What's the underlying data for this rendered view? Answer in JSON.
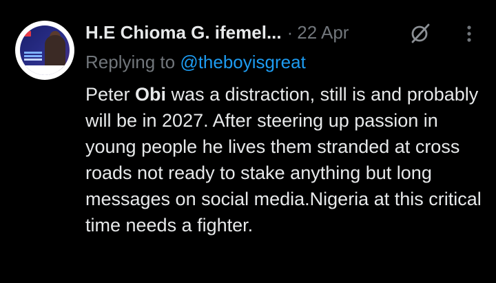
{
  "tweet": {
    "author": {
      "display_name": "H.E Chioma G. ifemel...",
      "avatar": "profile-avatar"
    },
    "separator": "·",
    "date": "22 Apr",
    "reply": {
      "prefix": "Replying to",
      "handle": "@theboyisgreat"
    },
    "body": {
      "part1": "Peter ",
      "bold": "Obi",
      "part2": " was a distraction, still is and probably will be in 2027. After steering up passion in young people he lives them stranded at cross roads not ready to stake anything but long messages on social media.Nigeria at this critical time needs a fighter."
    },
    "icons": {
      "grok": "grok-icon",
      "more": "more-options-icon"
    },
    "colors": {
      "background": "#000000",
      "text": "#e7e9ea",
      "muted": "#71767b",
      "link": "#1d9bf0"
    }
  }
}
